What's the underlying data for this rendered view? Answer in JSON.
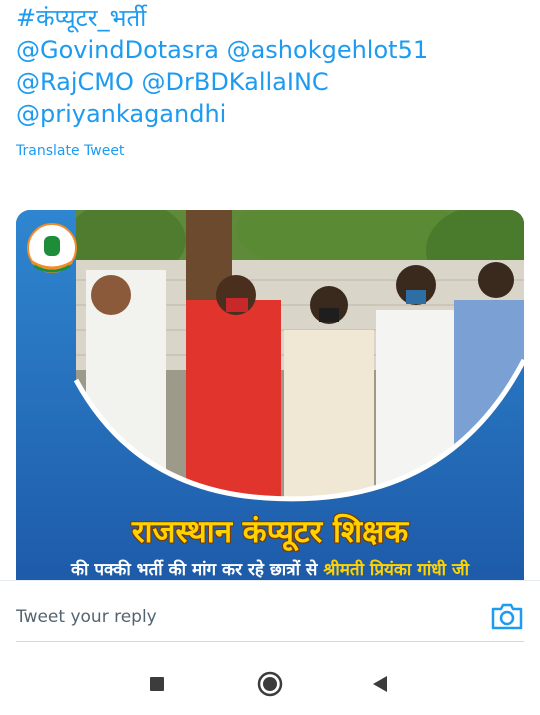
{
  "tweet": {
    "hashtag": "#कंप्यूटर_भर्ती",
    "mention_lines": [
      "@GovindDotasra @ashokgehlot51",
      "@RajCMO @DrBDKallaINC",
      "@priyankagandhi"
    ],
    "translate_label": "Translate Tweet"
  },
  "media": {
    "headline": "राजस्थान कंप्यूटर शिक्षक",
    "subline_part1": "की पक्की भर्ती की मांग कर रहे छात्रों से ",
    "subline_part2": "श्रीमती प्रियंका गांधी जी"
  },
  "reply": {
    "placeholder": "Tweet your reply",
    "camera_icon": "camera-icon"
  },
  "system_nav": {
    "icons": [
      "recents-square-icon",
      "home-circle-icon",
      "back-triangle-icon"
    ]
  },
  "colors": {
    "link_blue": "#1d9bf0",
    "poster_blue": "#2c7cc4",
    "headline_yellow": "#ffd200"
  }
}
